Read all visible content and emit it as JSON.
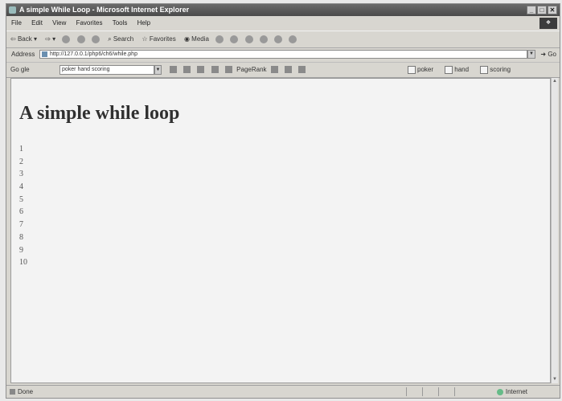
{
  "window": {
    "title": "A simple While Loop - Microsoft Internet Explorer",
    "controls": {
      "minimize": "_",
      "maximize": "□",
      "close": "✕"
    }
  },
  "menubar": {
    "items": [
      "File",
      "Edit",
      "View",
      "Favorites",
      "Tools",
      "Help"
    ]
  },
  "toolbar": {
    "back_label": "Back",
    "search_label": "Search",
    "favorites_label": "Favorites",
    "media_label": "Media"
  },
  "addressbar": {
    "label": "Address",
    "url": "http://127.0.0.1/php6/ch6/while.php",
    "go_label": "Go"
  },
  "googlebar": {
    "logo": "Go gle",
    "search_value": "poker hand scoring",
    "pagerank_label": "PageRank",
    "highlights": [
      "poker",
      "hand",
      "scoring"
    ]
  },
  "page": {
    "heading": "A simple while loop",
    "numbers": [
      "1",
      "2",
      "3",
      "4",
      "5",
      "6",
      "7",
      "8",
      "9",
      "10"
    ]
  },
  "statusbar": {
    "status_text": "Done",
    "zone_text": "Internet"
  },
  "colors": {
    "titlebar": "#4a4a4a",
    "page_bg": "#f3f3f3",
    "chrome": "#d8d6d0"
  }
}
